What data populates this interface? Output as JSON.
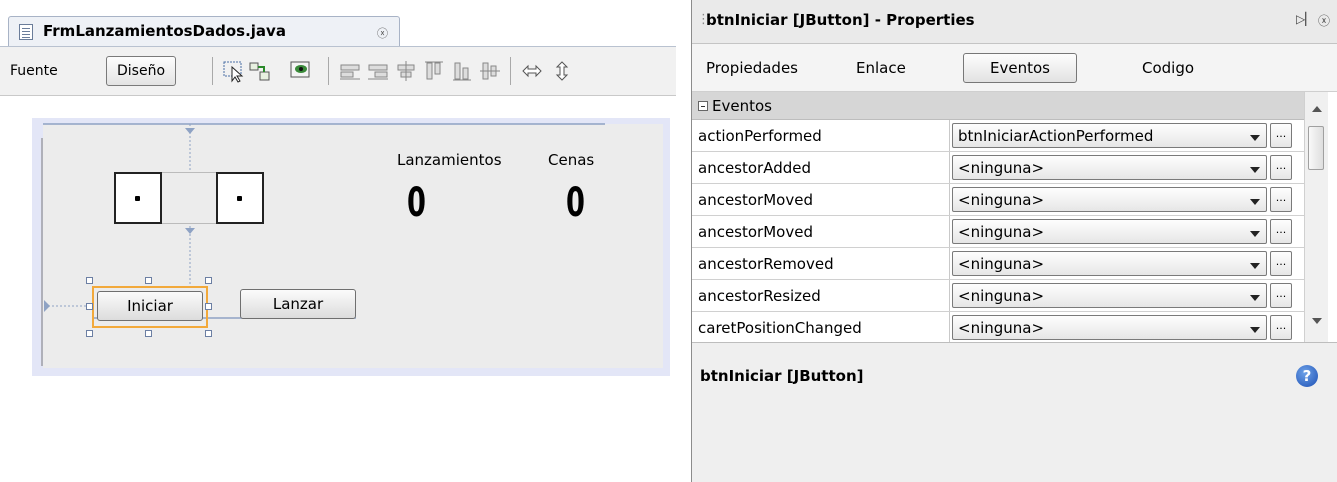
{
  "editor": {
    "tab_title": "FrmLanzamientosDados.java",
    "close_glyph": "ⓧ",
    "toolbar": {
      "source_label": "Fuente",
      "design_label": "Diseño"
    }
  },
  "form": {
    "label_lanzamientos": "Lanzamientos",
    "label_cenas": "Cenas",
    "value_lanzamientos": "0",
    "value_cenas": "0",
    "button_iniciar": "Iniciar",
    "button_lanzar": "Lanzar"
  },
  "properties": {
    "title": "btnIniciar [JButton] - Properties",
    "tabs": [
      "Propiedades",
      "Enlace",
      "Eventos",
      "Codigo"
    ],
    "selected_tab": "Eventos",
    "category": "Eventos",
    "rows": [
      {
        "name": "actionPerformed",
        "value": "btnIniciarActionPerformed"
      },
      {
        "name": "ancestorAdded",
        "value": "<ninguna>"
      },
      {
        "name": "ancestorMoved",
        "value": "<ninguna>"
      },
      {
        "name": "ancestorMoved",
        "value": "<ninguna>"
      },
      {
        "name": "ancestorRemoved",
        "value": "<ninguna>"
      },
      {
        "name": "ancestorResized",
        "value": "<ninguna>"
      },
      {
        "name": "caretPositionChanged",
        "value": "<ninguna>"
      }
    ],
    "ellipsis": "...",
    "description_title": "btnIniciar [JButton]",
    "help_glyph": "?"
  }
}
